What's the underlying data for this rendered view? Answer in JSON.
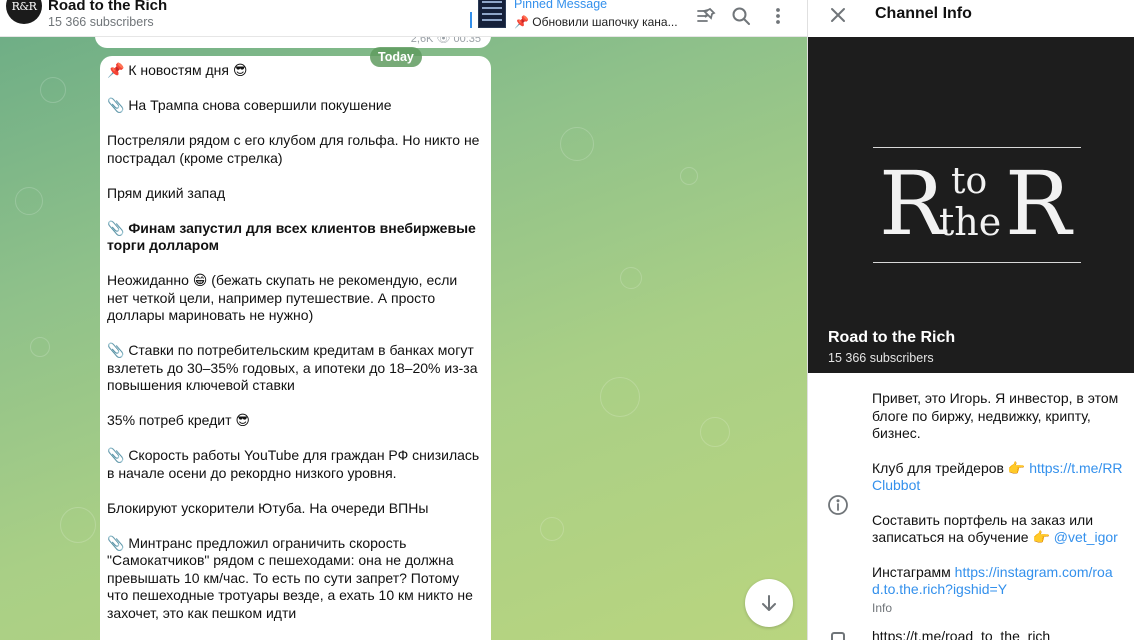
{
  "chat": {
    "channel_name": "Road to the Rich",
    "subscribers": "15 366 subscribers",
    "avatar_text": "R&R",
    "pinned": {
      "title": "Pinned Message",
      "text": "📌 Обновили шапочку кана..."
    },
    "prev_meta": "2,6K 👁 00:35",
    "date_label": "Today",
    "message": [
      {
        "text": "📌 К новостям дня 😎",
        "bold": false
      },
      {
        "text": "📎 На Трампа снова совершили покушение",
        "bold": false
      },
      {
        "text": "Постреляли рядом с его клубом для гольфа. Но никто не пострадал (кроме стрелка)",
        "bold": false
      },
      {
        "text": "Прям дикий запад",
        "bold": false
      },
      {
        "text": "📎 Финам запустил для всех клиентов внебиржевые торги долларом",
        "bold": true
      },
      {
        "text": "Неожиданно 😁 (бежать скупать не рекомендую, если нет четкой цели, например путешествие. А просто доллары мариновать не нужно)",
        "bold": false
      },
      {
        "text": "📎 Ставки по потребительским кредитам в банках могут взлететь до 30–35% годовых, а ипотеки до 18–20% из-за повышения ключевой ставки",
        "bold": false
      },
      {
        "text": "35% потреб кредит 😎",
        "bold": false
      },
      {
        "text": "📎 Скорость работы YouTube для граждан РФ снизилась в начале осени до рекордно низкого уровня.",
        "bold": false
      },
      {
        "text": "Блокируют ускорители Ютуба. На очереди ВПНы",
        "bold": false
      },
      {
        "text": "📎 Минтранс предложил ограничить скорость \"Самокатчиков\" рядом с пешеходами: она не должна превышать 10 км/час. То есть по сути запрет? Потому что пешеходные тротуары везде, а ехать 10 км никто не захочет, это как пешком идти",
        "bold": false
      }
    ]
  },
  "info": {
    "title": "Channel Info",
    "cover_name": "Road to the Rich",
    "cover_subscribers": "15 366 subscribers",
    "logo": {
      "r1": "R",
      "to": "to",
      "the": "the",
      "r2": "R"
    },
    "about_1": "Привет, это Игорь. Я инвестор, в этом блоге по биржу, недвижку, крипту, бизнес.",
    "about_2_text": "Клуб для трейдеров 👉 ",
    "about_2_link": "https://t.me/RRClubbot",
    "about_3_text": "Составить портфель на заказ или записаться на обучение 👉 ",
    "about_3_link": "@vet_igor",
    "about_4_text": "Инстаграмм ",
    "about_4_link": "https://instagram.com/road.to.the.rich?igshid=Y",
    "caption": "Info",
    "next_link": "https://t.me/road_to_the_rich"
  },
  "colors": {
    "accent": "#3390ec",
    "wallpaper_start": "#6fae86",
    "wallpaper_end": "#b9d57f",
    "cover_bg": "#1d1d1d"
  },
  "icons": {
    "pinned_list": "pinned-list-icon",
    "search": "search-icon",
    "more": "more-vertical-icon",
    "close": "close-icon",
    "info": "info-icon",
    "scroll_down": "arrow-down-icon"
  }
}
